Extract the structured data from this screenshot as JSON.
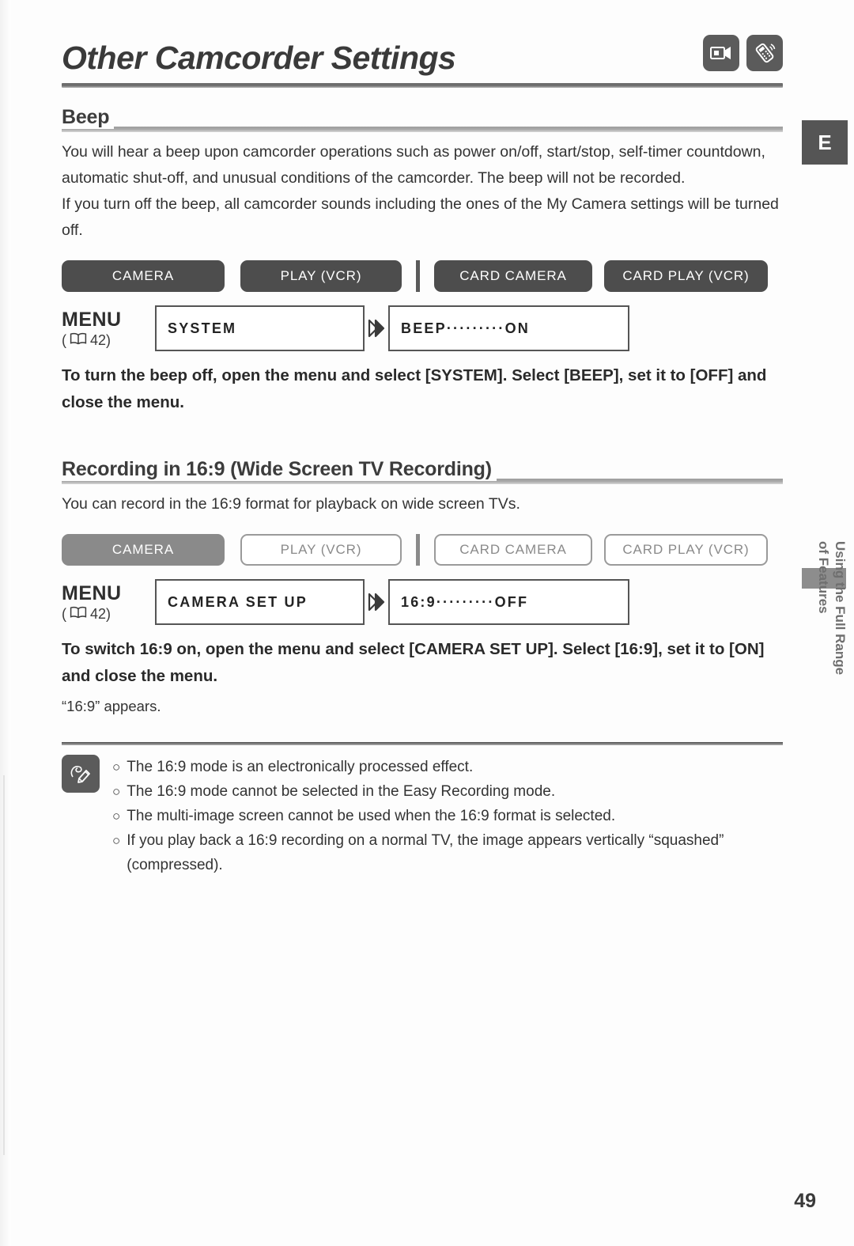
{
  "page": {
    "title": "Other Camcorder Settings",
    "number": "49",
    "tab_letter": "E",
    "side_tab_line1": "Using the Full Range",
    "side_tab_line2": "of Features"
  },
  "title_icons": [
    {
      "name": "camcorder-icon"
    },
    {
      "name": "remote-control-icon"
    }
  ],
  "sections": [
    {
      "heading": "Beep",
      "paragraphs": [
        "You will hear a beep upon camcorder operations such as power on/off, start/stop, self-timer countdown, automatic shut-off, and unusual conditions of the camcorder. The beep will not be recorded.",
        "If you turn off the beep, all camcorder sounds including the ones of the My Camera settings will be turned off."
      ],
      "modes": [
        {
          "label": "CAMERA",
          "state": "on"
        },
        {
          "label": "PLAY (VCR)",
          "state": "on"
        },
        {
          "label": "CARD CAMERA",
          "state": "on"
        },
        {
          "label": "CARD PLAY (VCR)",
          "state": "on"
        }
      ],
      "menu": {
        "label": "MENU",
        "reference": "42)",
        "reference_open": "(",
        "first_box": "SYSTEM",
        "second_box": "BEEP·········ON"
      },
      "instruction": "To turn the beep off, open the menu and select [SYSTEM]. Select [BEEP], set it to [OFF] and close the menu."
    },
    {
      "heading": "Recording in 16:9 (Wide Screen TV Recording)",
      "paragraphs": [
        "You can record in the 16:9 format for playback on wide screen TVs."
      ],
      "modes": [
        {
          "label": "CAMERA",
          "state": "on"
        },
        {
          "label": "PLAY (VCR)",
          "state": "off"
        },
        {
          "label": "CARD CAMERA",
          "state": "off"
        },
        {
          "label": "CARD PLAY (VCR)",
          "state": "off"
        }
      ],
      "menu": {
        "label": "MENU",
        "reference": "42)",
        "reference_open": "(",
        "first_box": "CAMERA SET UP",
        "second_box": "16:9·········OFF"
      },
      "instruction": "To switch 16:9 on, open the menu and select [CAMERA SET UP]. Select [16:9], set it to [ON] and close the menu.",
      "subnote": "“16:9” appears."
    }
  ],
  "notes": {
    "bullet": "○",
    "items": [
      "The 16:9 mode is an electronically processed effect.",
      "The 16:9 mode cannot be selected in the Easy Recording mode.",
      "The multi-image screen cannot be used when the 16:9 format is selected.",
      "If you play back a 16:9 recording on a normal TV, the image appears vertically “squashed” (compressed)."
    ]
  }
}
